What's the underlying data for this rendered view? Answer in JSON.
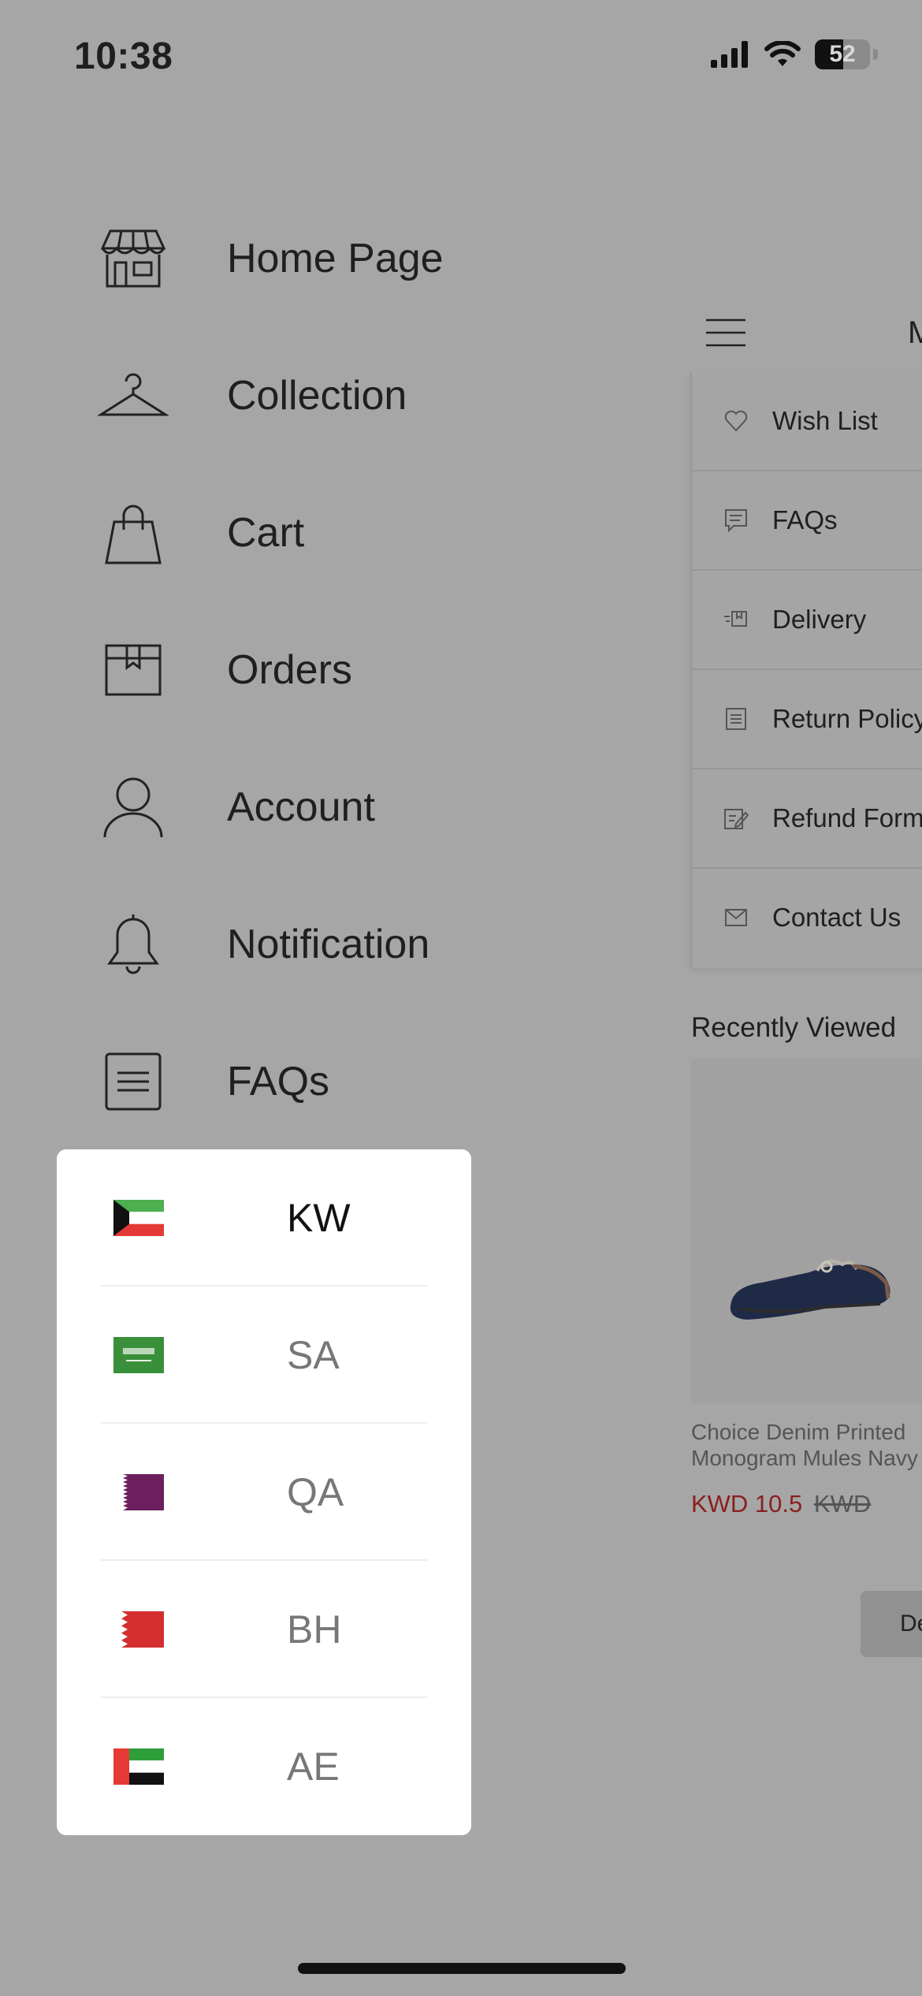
{
  "status_bar": {
    "time": "10:38",
    "battery_level": "52",
    "battery_fraction": 0.52
  },
  "menu": {
    "items": [
      {
        "label": "Home Page",
        "icon": "store-icon"
      },
      {
        "label": "Collection",
        "icon": "hanger-icon"
      },
      {
        "label": "Cart",
        "icon": "shopping-bag-icon"
      },
      {
        "label": "Orders",
        "icon": "box-icon"
      },
      {
        "label": "Account",
        "icon": "user-icon"
      },
      {
        "label": "Notification",
        "icon": "bell-icon"
      },
      {
        "label": "FAQs",
        "icon": "document-icon"
      }
    ]
  },
  "background_page": {
    "header_letter": "M",
    "dropdown": [
      {
        "label": "Wish List",
        "icon": "heart-icon"
      },
      {
        "label": "FAQs",
        "icon": "chat-icon"
      },
      {
        "label": "Delivery",
        "icon": "delivery-icon"
      },
      {
        "label": "Return Policy",
        "icon": "document-icon"
      },
      {
        "label": "Refund Form",
        "icon": "edit-icon"
      },
      {
        "label": "Contact Us",
        "icon": "mail-icon"
      }
    ],
    "recently_viewed_title": "Recently Viewed",
    "product": {
      "name": "Choice Denim Printed Monogram Mules Navy",
      "price": "KWD 10.5",
      "old_price": "KWD"
    },
    "button_label": "De"
  },
  "country_selector": {
    "selected": "KW",
    "countries": [
      {
        "code": "KW",
        "flag": "kuwait-flag-icon"
      },
      {
        "code": "SA",
        "flag": "saudi-flag-icon"
      },
      {
        "code": "QA",
        "flag": "qatar-flag-icon"
      },
      {
        "code": "BH",
        "flag": "bahrain-flag-icon"
      },
      {
        "code": "AE",
        "flag": "uae-flag-icon"
      }
    ]
  }
}
